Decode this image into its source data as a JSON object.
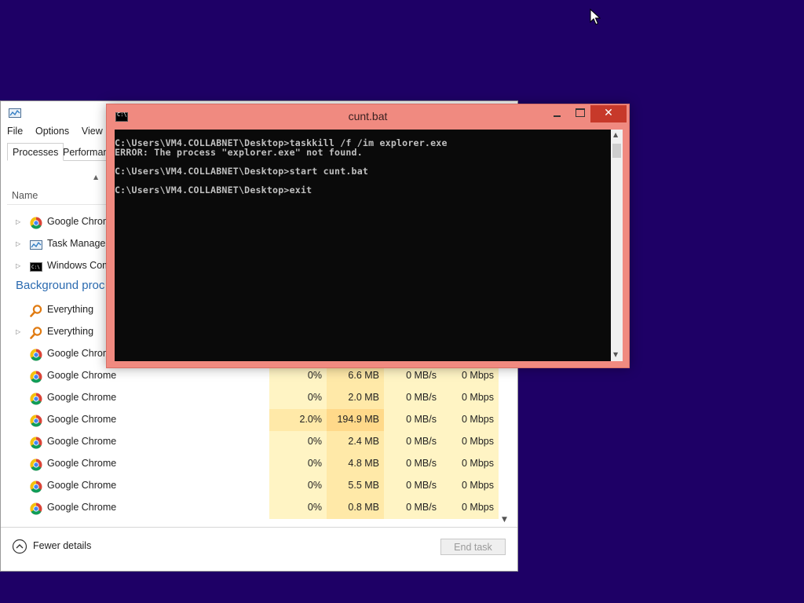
{
  "task_manager": {
    "menu": [
      "File",
      "Options",
      "View"
    ],
    "tabs": [
      "Processes",
      "Performan"
    ],
    "column_name": "Name",
    "apps": [
      {
        "name": "Google Chrom",
        "icon": "chrome-icon",
        "expandable": true
      },
      {
        "name": "Task Manager",
        "icon": "task-manager-icon",
        "expandable": true
      },
      {
        "name": "Windows Com",
        "icon": "cmd-icon",
        "expandable": true
      }
    ],
    "background_heading": "Background proc",
    "background": [
      {
        "name": "Everything",
        "icon": "everything-icon",
        "expandable": false
      },
      {
        "name": "Everything",
        "icon": "everything-icon",
        "expandable": true
      },
      {
        "name": "Google Chrom",
        "icon": "chrome-icon",
        "expandable": false
      }
    ],
    "processes": [
      {
        "name": "Google Chrome",
        "cpu": "0%",
        "memory": "6.6 MB",
        "disk": "0 MB/s",
        "network": "0 Mbps"
      },
      {
        "name": "Google Chrome",
        "cpu": "0%",
        "memory": "2.0 MB",
        "disk": "0 MB/s",
        "network": "0 Mbps"
      },
      {
        "name": "Google Chrome",
        "cpu": "2.0%",
        "memory": "194.9 MB",
        "disk": "0 MB/s",
        "network": "0 Mbps"
      },
      {
        "name": "Google Chrome",
        "cpu": "0%",
        "memory": "2.4 MB",
        "disk": "0 MB/s",
        "network": "0 Mbps"
      },
      {
        "name": "Google Chrome",
        "cpu": "0%",
        "memory": "4.8 MB",
        "disk": "0 MB/s",
        "network": "0 Mbps"
      },
      {
        "name": "Google Chrome",
        "cpu": "0%",
        "memory": "5.5 MB",
        "disk": "0 MB/s",
        "network": "0 Mbps"
      },
      {
        "name": "Google Chrome",
        "cpu": "0%",
        "memory": "0.8 MB",
        "disk": "0 MB/s",
        "network": "0 Mbps"
      }
    ],
    "fewer_details": "Fewer details",
    "end_task": "End task"
  },
  "cmd_window": {
    "title": "cunt.bat",
    "close_glyph": "✕",
    "lines": [
      "C:\\Users\\VM4.COLLABNET\\Desktop>taskkill /f /im explorer.exe",
      "ERROR: The process \"explorer.exe\" not found.",
      "",
      "C:\\Users\\VM4.COLLABNET\\Desktop>start cunt.bat",
      "",
      "C:\\Users\\VM4.COLLABNET\\Desktop>exit"
    ]
  },
  "colors": {
    "desktop": "#1e0066",
    "cmd_frame": "#f08a80",
    "close_button": "#c7392a",
    "section_heading": "#2a6ab0",
    "cpu_heat": "#fff4c4",
    "memory_heat": "#ffe9a8"
  }
}
